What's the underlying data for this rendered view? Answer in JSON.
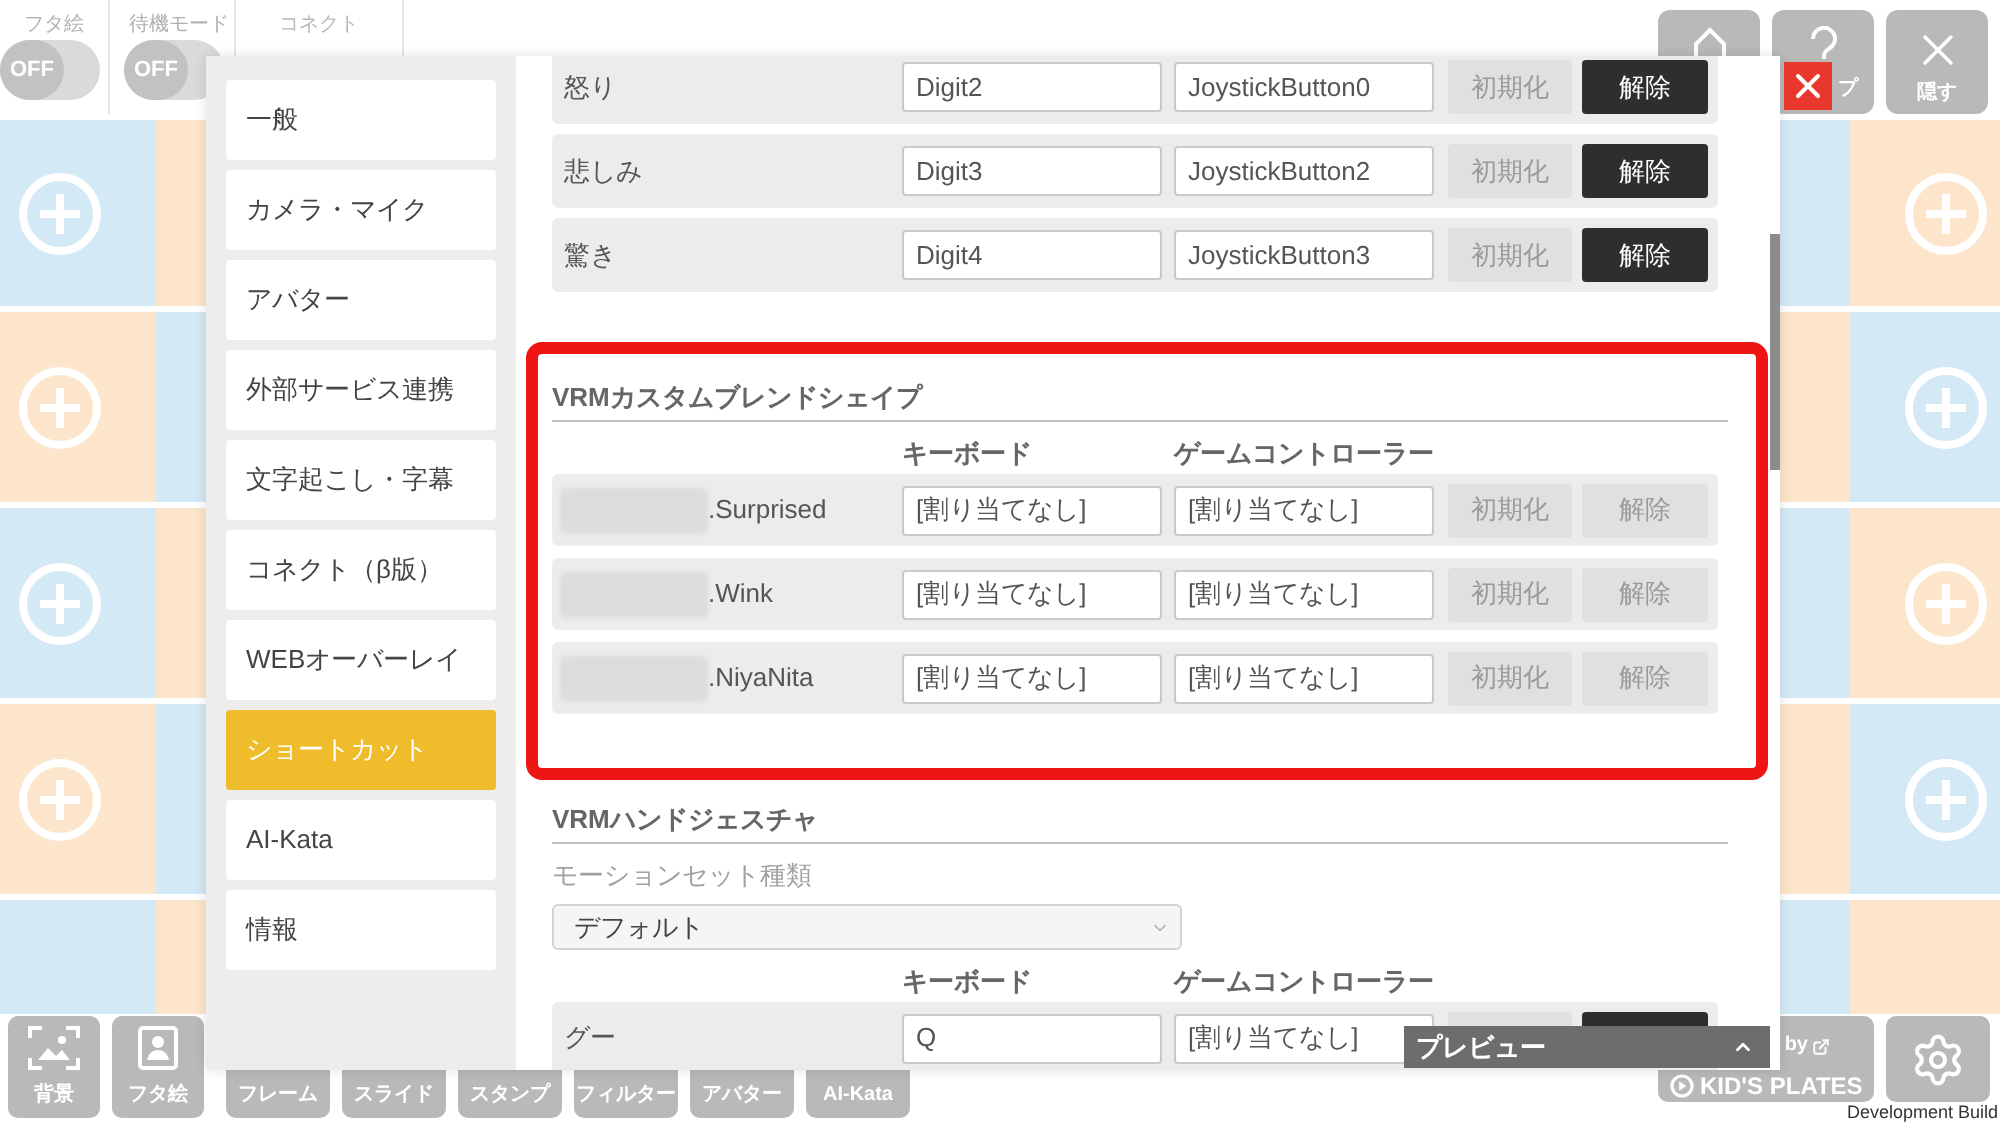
{
  "top_bar": {
    "toggles": [
      {
        "label": "フタ絵",
        "value": "OFF",
        "on": false
      },
      {
        "label": "待機モード",
        "value": "OFF",
        "on": false
      }
    ],
    "connect": {
      "label": "コネクト",
      "disabled": true
    },
    "window_buttons": [
      {
        "kind": "home"
      },
      {
        "kind": "help",
        "label": "プ"
      },
      {
        "kind": "hide",
        "label": "隠す"
      }
    ]
  },
  "settings_dialog": {
    "sidebar": {
      "items": [
        {
          "label": "一般",
          "selected": false
        },
        {
          "label": "カメラ・マイク",
          "selected": false
        },
        {
          "label": "アバター",
          "selected": false
        },
        {
          "label": "外部サービス連携",
          "selected": false
        },
        {
          "label": "文字起こし・字幕",
          "selected": false
        },
        {
          "label": "コネクト（β版）",
          "selected": false
        },
        {
          "label": "WEBオーバーレイ",
          "selected": false
        },
        {
          "label": "ショートカット",
          "selected": true
        },
        {
          "label": "AI-Kata",
          "selected": false
        },
        {
          "label": "情報",
          "selected": false
        }
      ]
    },
    "shortcut_rows": [
      {
        "label": "怒り",
        "keyboard": "Digit2",
        "controller": "JoystickButton0",
        "buttons": [
          {
            "label": "初期化",
            "enabled": false
          },
          {
            "label": "解除",
            "enabled": true
          }
        ]
      },
      {
        "label": "悲しみ",
        "keyboard": "Digit3",
        "controller": "JoystickButton2",
        "buttons": [
          {
            "label": "初期化",
            "enabled": false
          },
          {
            "label": "解除",
            "enabled": true
          }
        ]
      },
      {
        "label": "驚き",
        "keyboard": "Digit4",
        "controller": "JoystickButton3",
        "buttons": [
          {
            "label": "初期化",
            "enabled": false
          },
          {
            "label": "解除",
            "enabled": true
          }
        ]
      }
    ],
    "sections": [
      {
        "title": "VRMカスタムブレンドシェイプ",
        "highlighted": true,
        "columns": [
          "キーボード",
          "ゲームコントローラー"
        ],
        "rows": [
          {
            "label": ".Surprised",
            "redacted": true,
            "keyboard": "[割り当てなし]",
            "controller": "[割り当てなし]",
            "buttons": [
              {
                "label": "初期化",
                "enabled": false
              },
              {
                "label": "解除",
                "enabled": false
              }
            ]
          },
          {
            "label": ".Wink",
            "redacted": true,
            "keyboard": "[割り当てなし]",
            "controller": "[割り当てなし]",
            "buttons": [
              {
                "label": "初期化",
                "enabled": false
              },
              {
                "label": "解除",
                "enabled": false
              }
            ]
          },
          {
            "label": ".NiyaNita",
            "redacted": true,
            "keyboard": "[割り当てなし]",
            "controller": "[割り当てなし]",
            "buttons": [
              {
                "label": "初期化",
                "enabled": false
              },
              {
                "label": "解除",
                "enabled": false
              }
            ]
          }
        ]
      },
      {
        "title": "VRMハンドジェスチャ",
        "highlighted": false,
        "motion_set": {
          "label": "モーションセット種類",
          "value": "デフォルト"
        },
        "columns": [
          "キーボード",
          "ゲームコントローラー"
        ],
        "rows": [
          {
            "label": "グー",
            "redacted": false,
            "keyboard": "Q",
            "controller": "[割り当てなし]",
            "buttons": [
              {
                "enabled": false
              },
              {
                "enabled": true
              }
            ]
          }
        ]
      }
    ]
  },
  "preview_bar": {
    "label": "プレビュー",
    "expanded": false
  },
  "bottom_toolbar": {
    "buttons": [
      {
        "kind": "picture",
        "label": "背景"
      },
      {
        "kind": "portrait",
        "label": "フタ絵"
      },
      {
        "kind": "label",
        "label": "フレーム"
      },
      {
        "kind": "label",
        "label": "スライド"
      },
      {
        "kind": "label",
        "label": "スタンプ"
      },
      {
        "kind": "label",
        "label": "フィルター"
      },
      {
        "kind": "label",
        "label": "アバター"
      },
      {
        "kind": "label",
        "label": "AI-Kata"
      }
    ],
    "credit": {
      "by": "by",
      "logo": "KID'S PLATES"
    },
    "build_label": "Development Build"
  }
}
